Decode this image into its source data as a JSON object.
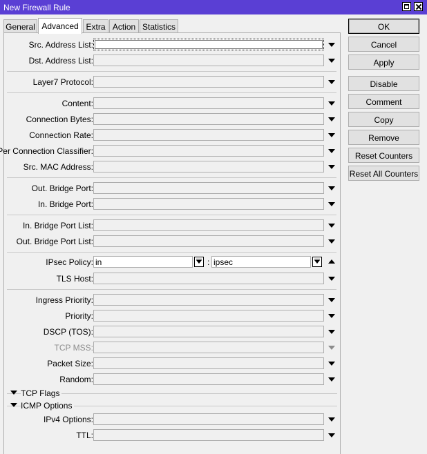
{
  "window": {
    "title": "New Firewall Rule"
  },
  "tabs": [
    {
      "label": "General"
    },
    {
      "label": "Advanced"
    },
    {
      "label": "Extra"
    },
    {
      "label": "Action"
    },
    {
      "label": "Statistics"
    }
  ],
  "fields": {
    "src_address_list": "Src. Address List:",
    "dst_address_list": "Dst. Address List:",
    "layer7_protocol": "Layer7 Protocol:",
    "content": "Content:",
    "connection_bytes": "Connection Bytes:",
    "connection_rate": "Connection Rate:",
    "per_connection_classifier": "Per Connection Classifier:",
    "src_mac_address": "Src. MAC Address:",
    "out_bridge_port": "Out. Bridge Port:",
    "in_bridge_port": "In. Bridge Port:",
    "in_bridge_port_list": "In. Bridge Port List:",
    "out_bridge_port_list": "Out. Bridge Port List:",
    "ipsec_policy": "IPsec Policy:",
    "tls_host": "TLS Host:",
    "ingress_priority": "Ingress Priority:",
    "priority": "Priority:",
    "dscp": "DSCP (TOS):",
    "tcp_mss": "TCP MSS:",
    "packet_size": "Packet Size:",
    "random": "Random:",
    "ipv4_options": "IPv4 Options:",
    "ttl": "TTL:"
  },
  "ipsec": {
    "direction": "in",
    "separator": ":",
    "policy": "ipsec"
  },
  "sections": {
    "tcp_flags": "TCP Flags",
    "icmp_options": "ICMP Options"
  },
  "buttons": {
    "ok": "OK",
    "cancel": "Cancel",
    "apply": "Apply",
    "disable": "Disable",
    "comment": "Comment",
    "copy": "Copy",
    "remove": "Remove",
    "reset_counters": "Reset Counters",
    "reset_all_counters": "Reset All Counters"
  }
}
